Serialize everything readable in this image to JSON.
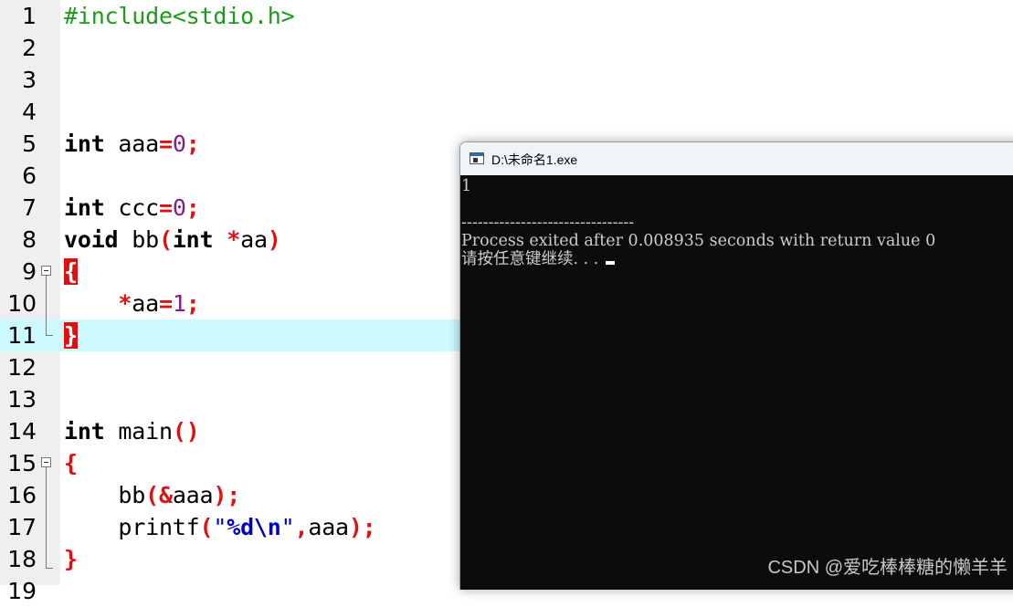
{
  "editor": {
    "line_numbers": [
      "1",
      "2",
      "3",
      "4",
      "5",
      "6",
      "7",
      "8",
      "9",
      "10",
      "11",
      "12",
      "13",
      "14",
      "15",
      "16",
      "17",
      "18",
      "19"
    ],
    "code": {
      "l1": "#include<stdio.h>",
      "l5_kw": "int",
      "l5_id": " aaa",
      "l5_eq": "=",
      "l5_num": "0",
      "l5_semi": ";",
      "l7_kw": "int",
      "l7_id": " ccc",
      "l7_eq": "=",
      "l7_num": "0",
      "l7_semi": ";",
      "l8_kw1": "void",
      "l8_id": " bb",
      "l8_lp": "(",
      "l8_kw2": "int",
      "l8_star": " *",
      "l8_id2": "aa",
      "l8_rp": ")",
      "l9_brace": "{",
      "l10_indent": "    ",
      "l10_star": "*",
      "l10_id": "aa",
      "l10_eq": "=",
      "l10_num": "1",
      "l10_semi": ";",
      "l11_brace": "}",
      "l14_kw": "int",
      "l14_id": " main",
      "l14_parens": "()",
      "l15_brace": "{",
      "l16_indent": "    ",
      "l16_id": "bb",
      "l16_lp": "(&",
      "l16_arg": "aaa",
      "l16_rp": ");",
      "l17_indent": "    ",
      "l17_id": "printf",
      "l17_lp": "(",
      "l17_str1": "\"",
      "l17_fmt": "%d\\n",
      "l17_str2": "\"",
      "l17_comma": ",",
      "l17_arg": "aaa",
      "l17_rp": ");",
      "l18_brace": "}"
    }
  },
  "console": {
    "title": "D:\\未命名1.exe",
    "icon": "console-window-icon",
    "output_lines": [
      "1",
      "",
      "--------------------------------",
      "Process exited after 0.008935 seconds with return value 0",
      "请按任意键继续. . ."
    ]
  },
  "watermark": "CSDN @爱吃棒棒糖的懒羊羊",
  "colors": {
    "editor_bg": "#ffffff",
    "gutter_bg": "#efefef",
    "active_line": "#ccfaff",
    "keyword": "#000000",
    "preprocessor": "#1a9c1a",
    "operator": "#e01010",
    "number": "#8a1a8a",
    "string": "#0000cc",
    "brace_highlight": "#e01010",
    "console_bg": "#0c0c0c",
    "console_text": "#cccccc",
    "titlebar_bg": "#eef4f8"
  }
}
